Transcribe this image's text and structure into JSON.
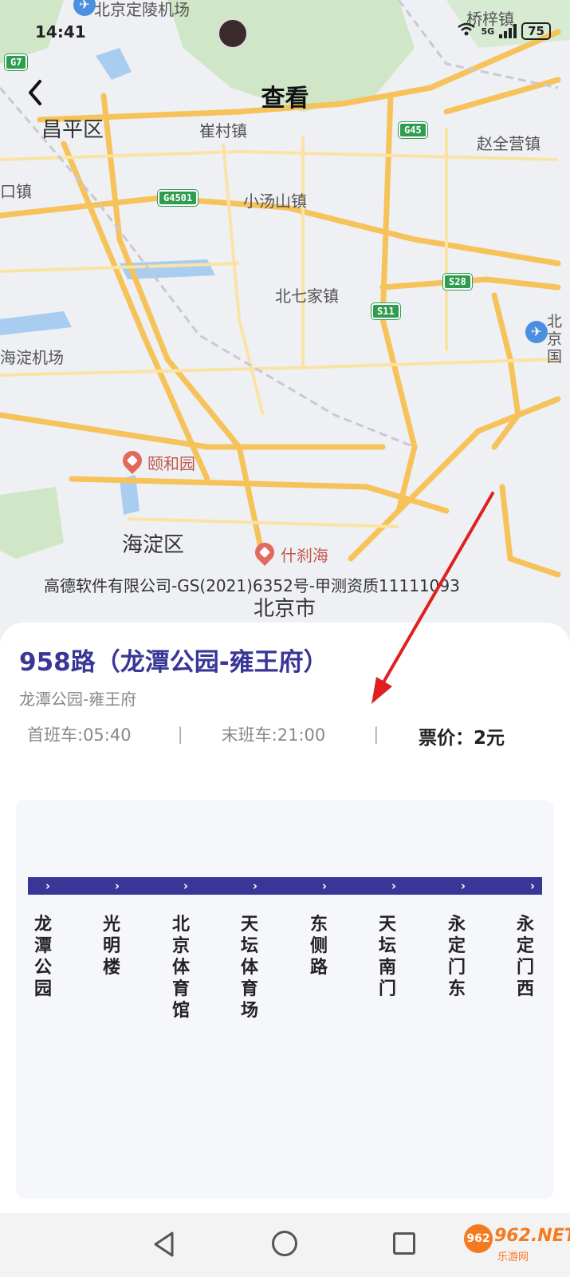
{
  "status_bar": {
    "time": "14:41",
    "network": "5G",
    "battery": "75"
  },
  "header": {
    "title": "查看",
    "back_icon": "chevron-left-icon"
  },
  "map": {
    "labels": {
      "airport_top": "北京定陵机场",
      "qiaozi": "桥梓镇",
      "changping": "昌平区",
      "cuicun": "崔村镇",
      "zhaoquanying": "赵全营镇",
      "kou": "口镇",
      "xiaotangshan": "小汤山镇",
      "beiqijia": "北七家镇",
      "haidian_airport": "海淀机场",
      "capital_airport": "北京国",
      "yiheyuan": "颐和园",
      "haidian": "海淀区",
      "shichahai": "什刹海",
      "beijing": "北京市"
    },
    "highways": {
      "g7": "G7",
      "g45": "G45",
      "g4501": "G4501",
      "s28": "S28",
      "s11": "S11"
    },
    "copyright": "高德软件有限公司-GS(2021)6352号-甲测资质11111093"
  },
  "route": {
    "title": "958路（龙潭公园-雍王府）",
    "subtitle": "龙潭公园-雍王府",
    "first_bus": "首班车:05:40",
    "last_bus": "末班车:21:00",
    "separator": "|",
    "price": "票价：2元",
    "stops": [
      "龙潭公园",
      "光明楼",
      "北京体育馆",
      "天坛体育场",
      "东侧路",
      "天坛南门",
      "永定门东",
      "永定门西"
    ],
    "direction_glyph": "›"
  },
  "watermark": {
    "brand": "962.NET",
    "sub": "乐游网",
    "logo": "962"
  },
  "colors": {
    "accent": "#3a3697",
    "annotation": "#e02020",
    "highway": "#2e9d4f",
    "road": "#f6c25a"
  }
}
